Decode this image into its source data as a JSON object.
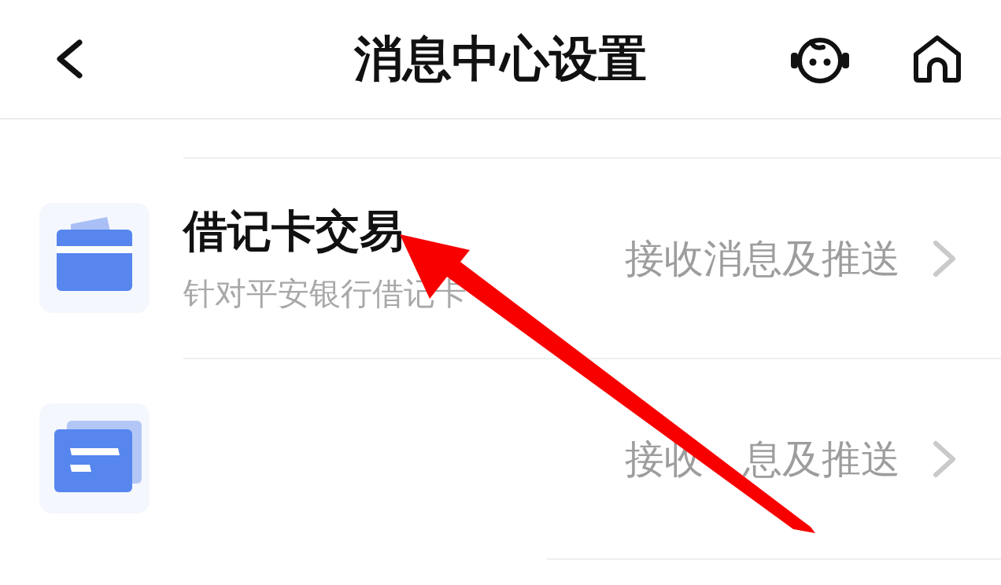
{
  "header": {
    "title": "消息中心设置"
  },
  "items": [
    {
      "kind": "debit-card",
      "title": "借记卡交易",
      "subtitle": "针对平安银行借记卡",
      "action_parts": [
        "接收消息及推送"
      ]
    },
    {
      "kind": "stacked-cards",
      "action_parts": [
        "接收",
        "息及推送"
      ]
    }
  ],
  "annotations": [
    {
      "kind": "arrow"
    }
  ]
}
